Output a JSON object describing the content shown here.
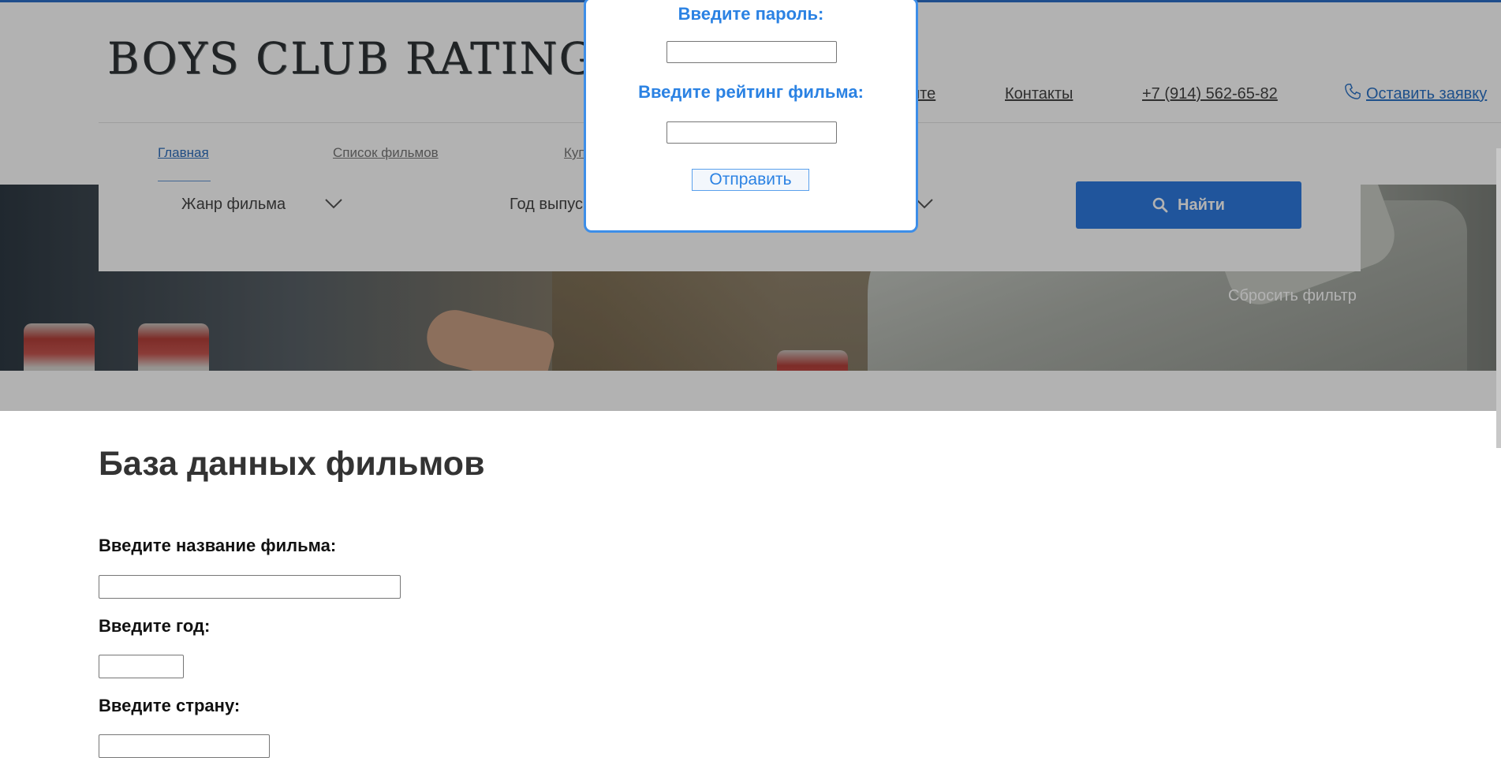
{
  "header": {
    "logo": "BOYS CLUB RATING",
    "top_nav": [
      {
        "label": "йте"
      },
      {
        "label": "Контакты"
      },
      {
        "label": "+7 (914) 562-65-82"
      },
      {
        "label": "Оставить заявку"
      }
    ],
    "main_nav": [
      {
        "label": "Главная",
        "active": true
      },
      {
        "label": "Список фильмов",
        "active": false
      },
      {
        "label": "Куп",
        "active": false
      }
    ]
  },
  "filters": {
    "genre": "Жанр фильма",
    "year": "Год выпус",
    "find_button": "Найти",
    "reset": "Сбросить фильтр"
  },
  "modal": {
    "password_label": "Введите пароль:",
    "password_value": "",
    "rating_label": "Введите рейтинг фильма:",
    "rating_value": "",
    "submit": "Отправить"
  },
  "content": {
    "title": "База данных фильмов",
    "fields": [
      {
        "label": "Введите название фильма:",
        "value": ""
      },
      {
        "label": "Введите год:",
        "value": ""
      },
      {
        "label": "Введите страну:",
        "value": ""
      }
    ]
  },
  "colors": {
    "accent": "#2b82e3",
    "find_button": "#2f7ae0",
    "header_line": "#1f4e8c"
  },
  "icons": {
    "phone": "phone-icon",
    "search": "search-icon",
    "chevron": "chevron-down-icon"
  }
}
